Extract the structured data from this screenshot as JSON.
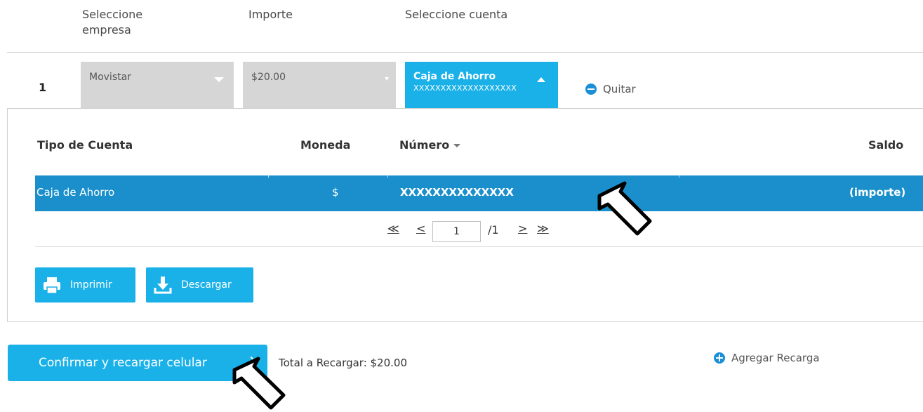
{
  "header": {
    "col_company": "Seleccione empresa",
    "col_amount": "Importe",
    "col_account": "Seleccione cuenta"
  },
  "recharge_row": {
    "number": "1",
    "company_value": "Movistar",
    "amount_value": "$20.00",
    "account_type": "Caja de Ahorro",
    "account_number": "XXXXXXXXXXXXXXXXXXX",
    "remove_label": "Quitar"
  },
  "accounts_table": {
    "columns": {
      "type": "Tipo de Cuenta",
      "currency": "Moneda",
      "number": "Número",
      "balance": "Saldo"
    },
    "rows": [
      {
        "type": "Caja de Ahorro",
        "currency": "$",
        "number": "XXXXXXXXXXXXXX",
        "balance": "(importe)"
      }
    ]
  },
  "pagination": {
    "first": "≪",
    "prev": "<",
    "current_page": "1",
    "total": "/1",
    "next": ">",
    "last": "≫"
  },
  "actions": {
    "print_label": "Imprimir",
    "download_label": "Descargar"
  },
  "footer": {
    "confirm_label": "Confirmar y recargar celular",
    "total_label": "Total a Recargar: $20.00",
    "add_label": "Agregar Recarga"
  },
  "colors": {
    "accent": "#1ab1e8",
    "selected_row": "#1a8fcb",
    "disabled_select": "#d6d6d6"
  }
}
